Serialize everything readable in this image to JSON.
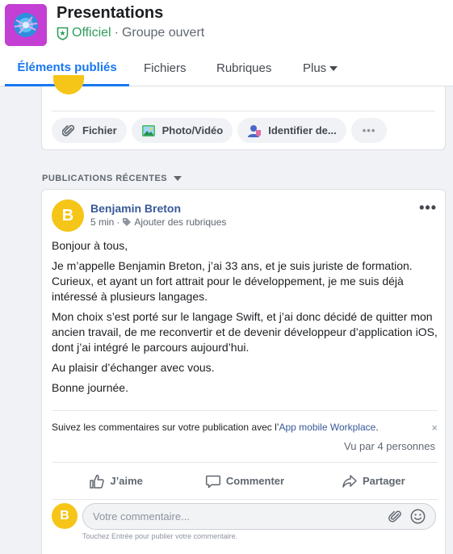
{
  "group": {
    "title": "Presentations",
    "official": "Officiel",
    "separator": "·",
    "type": "Groupe ouvert"
  },
  "tabs": [
    {
      "label": "Éléments publiés",
      "active": true
    },
    {
      "label": "Fichiers"
    },
    {
      "label": "Rubriques"
    },
    {
      "label": "Plus"
    }
  ],
  "composer": {
    "chips": [
      {
        "label": "Fichier",
        "icon": "paperclip-icon"
      },
      {
        "label": "Photo/Vidéo",
        "icon": "photo-icon"
      },
      {
        "label": "Identifier de...",
        "icon": "tag-user-icon"
      },
      {
        "label": "•••",
        "icon": "more-icon"
      }
    ]
  },
  "section": {
    "title": "PUBLICATIONS RÉCENTES"
  },
  "post": {
    "avatar_letter": "B",
    "author": "Benjamin Breton",
    "time": "5 min",
    "dot": "·",
    "add_topics": "Ajouter des rubriques",
    "more": "•••",
    "paragraphs": [
      "Bonjour à tous,",
      "Je m’appelle Benjamin Breton, j’ai 33 ans, et je suis juriste de formation. Curieux, et ayant un fort attrait pour le développement, je me suis déjà intéressé à plusieurs langages.",
      "Mon choix s’est porté sur le langage Swift, et j’ai donc décidé de quitter mon ancien travail, de me reconvertir et de devenir développeur d’application iOS, dont j’ai intégré le parcours aujourd’hui.",
      "Au plaisir d’échanger avec vous.",
      "Bonne journée."
    ],
    "notice_text": "Suivez les commentaires sur votre publication avec l’",
    "notice_link": "App mobile Workplace",
    "notice_end": ".",
    "notice_close": "×",
    "seen_by": "Vu par 4 personnes",
    "actions": {
      "like": "J’aime",
      "comment": "Commenter",
      "share": "Partager"
    },
    "comment": {
      "avatar_letter": "B",
      "placeholder": "Votre commentaire...",
      "hint": "Touchez Entrée pour publier votre commentaire."
    }
  },
  "colors": {
    "accent": "#1877f2",
    "official_green": "#2e9e5b",
    "avatar_yellow": "#f5c518",
    "group_avatar": "#c43fd3",
    "author_link": "#385898"
  }
}
